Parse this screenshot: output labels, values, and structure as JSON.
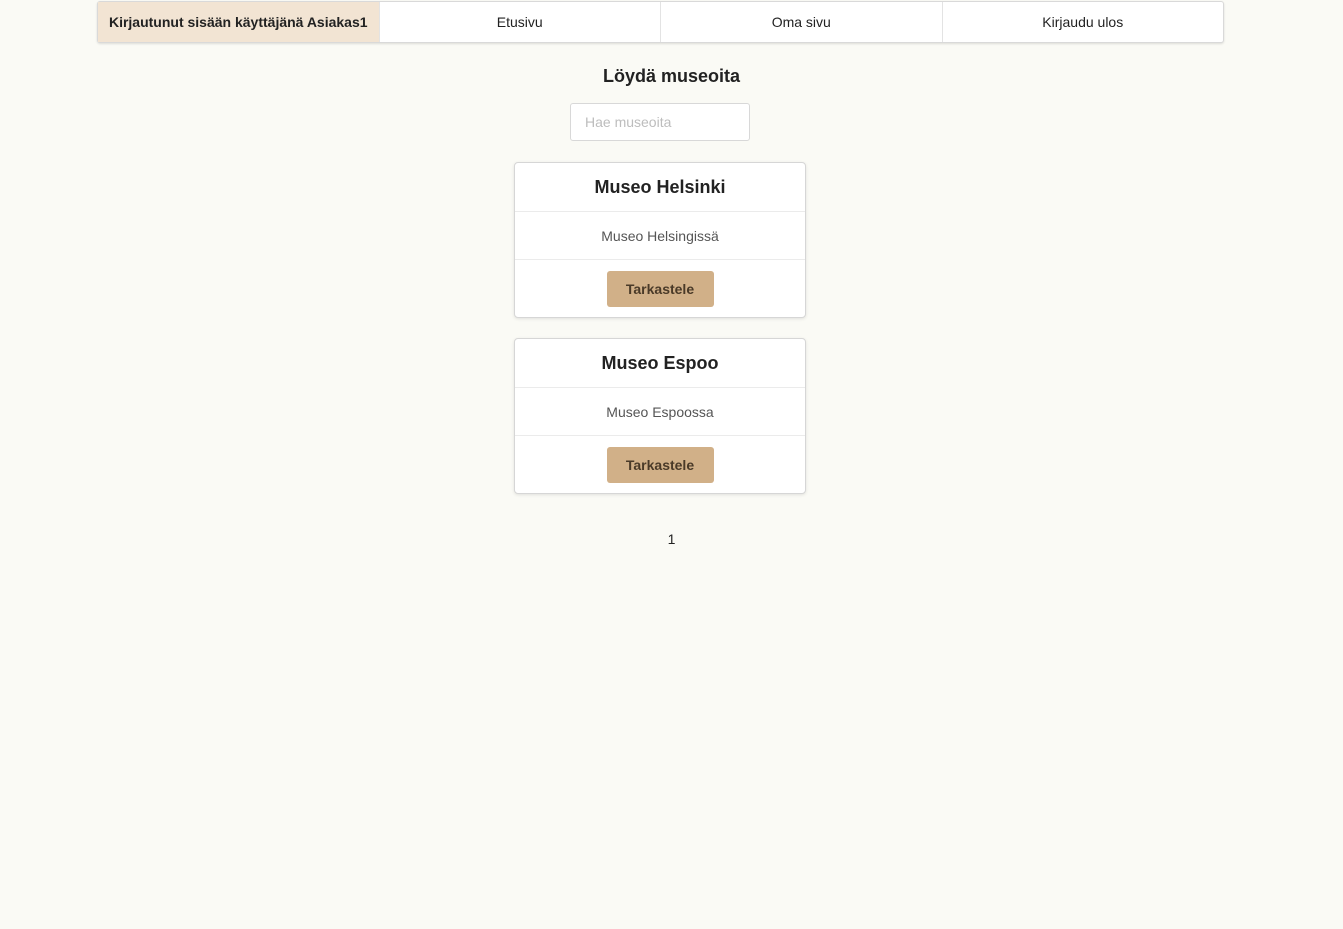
{
  "nav": {
    "user_label": "Kirjautunut sisään käyttäjänä Asiakas1",
    "home": "Etusivu",
    "my_page": "Oma sivu",
    "logout": "Kirjaudu ulos"
  },
  "heading": "Löydä museoita",
  "search": {
    "placeholder": "Hae museoita",
    "value": ""
  },
  "museums": [
    {
      "name": "Museo Helsinki",
      "description": "Museo Helsingissä",
      "button": "Tarkastele"
    },
    {
      "name": "Museo Espoo",
      "description": "Museo Espoossa",
      "button": "Tarkastele"
    }
  ],
  "pagination": {
    "current_page": "1"
  },
  "colors": {
    "background": "#fafaf5",
    "user_highlight": "#f2e4d3",
    "button": "#d1b088"
  }
}
